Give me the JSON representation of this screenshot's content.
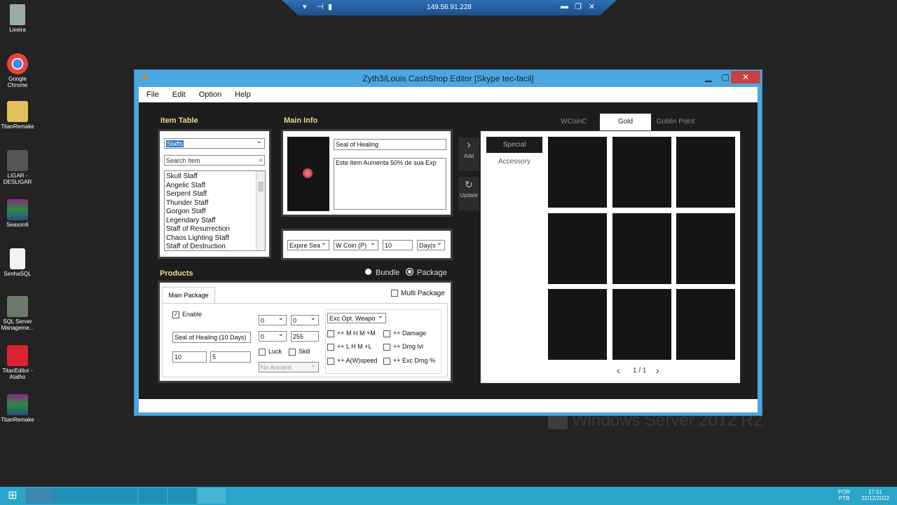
{
  "remote": {
    "ip": "149.56.91.228"
  },
  "desktop": {
    "icons": [
      "Lixeira",
      "Google Chrome",
      "TitanRemake",
      "LIGAR - DESLIGAR",
      "Season6",
      "SenhaSQL",
      "SQL Server Manageme...",
      "TitanEditor - Atalho",
      "TitanRemake"
    ],
    "watermark": "Windows Server 2012 R2"
  },
  "window": {
    "title": "Zyth3/Louis CashShop Editor [Skype tec-facil]",
    "menu": [
      "File",
      "Edit",
      "Option",
      "Help"
    ]
  },
  "item_table": {
    "header": "Item Table",
    "category": "Staffs",
    "search_placeholder": "Search Item",
    "items": [
      "Skull Staff",
      "Angelic Staff",
      "Serpent Staff",
      "Thunder Staff",
      "Gorgon Staff",
      "Legendary Staff",
      "Staff of Resurrection",
      "Chaos Lighting Staff",
      "Staff of Destruction"
    ]
  },
  "main_info": {
    "header": "Main Info",
    "name": "Seal of Healing",
    "description": "Este item Aumenta 50% de sua Exp",
    "expire": "Expire Sea",
    "currency": "W Coin (P)",
    "amount": "10",
    "unit": "Day(s"
  },
  "side_buttons": {
    "add": "Add",
    "update": "Update"
  },
  "products": {
    "header": "Products",
    "bundle": "Bundle",
    "package": "Package",
    "multi_package": "Multi Package",
    "tab": "Main Package",
    "enable": "Enable",
    "package_name": "Seal of Healing (10 Days)",
    "val1": "10",
    "val2": "5",
    "sel1": "0",
    "sel2": "0",
    "sel3": "0",
    "field255": "255",
    "luck": "Luck",
    "skill": "Skill",
    "ancient": "No Ancient",
    "exc_opt": "Exc Opt. Weapo",
    "opts": [
      "++ M H M +M",
      "++ Damage",
      "++ L H M +L",
      "++ Dmg lvl",
      "++ A(W)speed",
      "++ Exc Dmg %"
    ]
  },
  "shop": {
    "tabs": [
      "WCoinC",
      "Gold",
      "Goblin Point"
    ],
    "categories": [
      "Special",
      "Accessory"
    ],
    "page": "1 / 1"
  },
  "tray": {
    "lang1": "POR",
    "lang2": "PTB",
    "time": "17:51",
    "date": "22/12/2022"
  }
}
